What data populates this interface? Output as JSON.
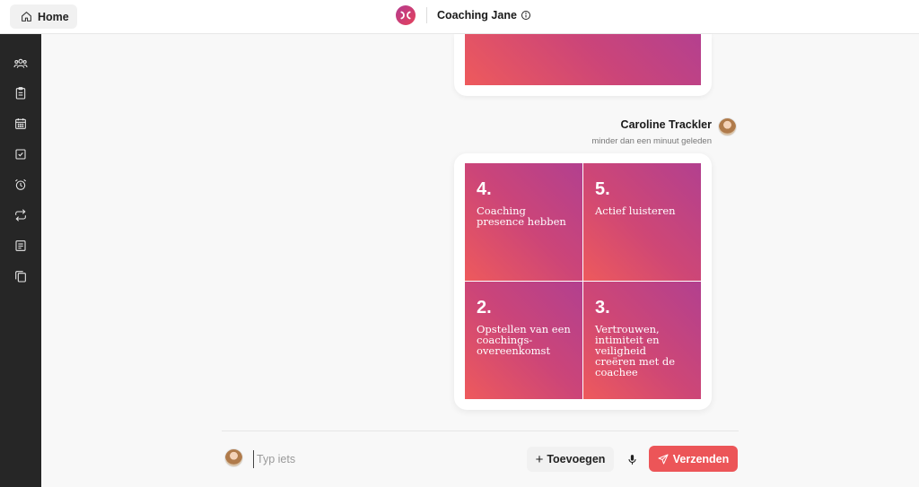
{
  "header": {
    "home_label": "Home",
    "title": "Coaching Jane"
  },
  "sidebar": {
    "items": [
      {
        "icon": "users-icon"
      },
      {
        "icon": "clipboard-icon"
      },
      {
        "icon": "calendar-icon"
      },
      {
        "icon": "checkbox-icon"
      },
      {
        "icon": "alarm-icon"
      },
      {
        "icon": "repeat-icon"
      },
      {
        "icon": "document-icon"
      },
      {
        "icon": "copy-icon"
      }
    ]
  },
  "message": {
    "sender": "Caroline Trackler",
    "timestamp": "minder dan een minuut geleden",
    "tiles": [
      {
        "number": "4.",
        "text": "Coaching presence hebben"
      },
      {
        "number": "5.",
        "text": "Actief luisteren"
      },
      {
        "number": "2.",
        "text": "Opstellen van een coachings-overeenkomst"
      },
      {
        "number": "3.",
        "text": "Vertrouwen, intimiteit en veiligheid creëren met de coachee"
      }
    ]
  },
  "composer": {
    "placeholder": "Typ iets",
    "add_label": "Toevoegen",
    "send_label": "Verzenden"
  },
  "colors": {
    "accent": "#ec5558",
    "sidebar": "#262626",
    "gradient_start": "#ee5a5c",
    "gradient_end": "#b2408f"
  }
}
